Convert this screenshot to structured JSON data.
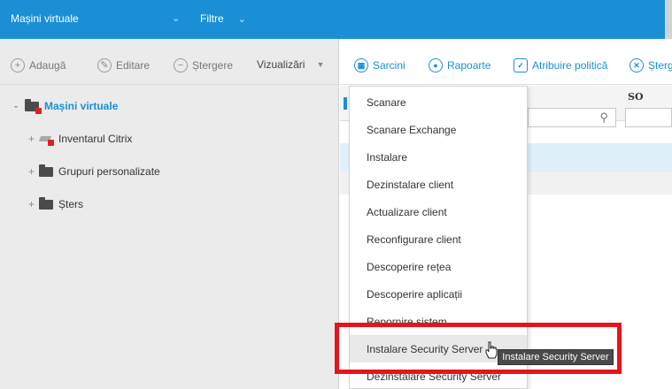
{
  "topbar": {
    "virtual_machines": "Mașini virtuale",
    "filters": "Filtre"
  },
  "left_toolbar": {
    "add": "Adaugă",
    "edit": "Editare",
    "delete": "Ștergere",
    "views": "Vizualizări"
  },
  "tree": {
    "root": "Mașini virtuale",
    "items": [
      {
        "label": "Inventarul Citrix",
        "icon": "citrix-icon"
      },
      {
        "label": "Grupuri personalizate",
        "icon": "folder-icon"
      },
      {
        "label": "Șters",
        "icon": "folder-icon"
      }
    ]
  },
  "right_toolbar": {
    "tasks": "Sarcini",
    "reports": "Rapoarte",
    "assign_policy": "Atribuire politică",
    "delete": "Șterg"
  },
  "grid": {
    "os_header": "SO"
  },
  "menu": {
    "items": [
      "Scanare",
      "Scanare Exchange",
      "Instalare",
      "Dezinstalare client",
      "Actualizare client",
      "Reconfigurare client",
      "Descoperire rețea",
      "Descoperire aplicații",
      "Repornire sistem",
      "Instalare Security Server",
      "Dezinstalare Security Server"
    ],
    "hovered_index": 9
  },
  "tooltip": "Instalare Security Server",
  "colors": {
    "brand_blue": "#1b8fd6",
    "highlight_red": "#e8141b"
  }
}
